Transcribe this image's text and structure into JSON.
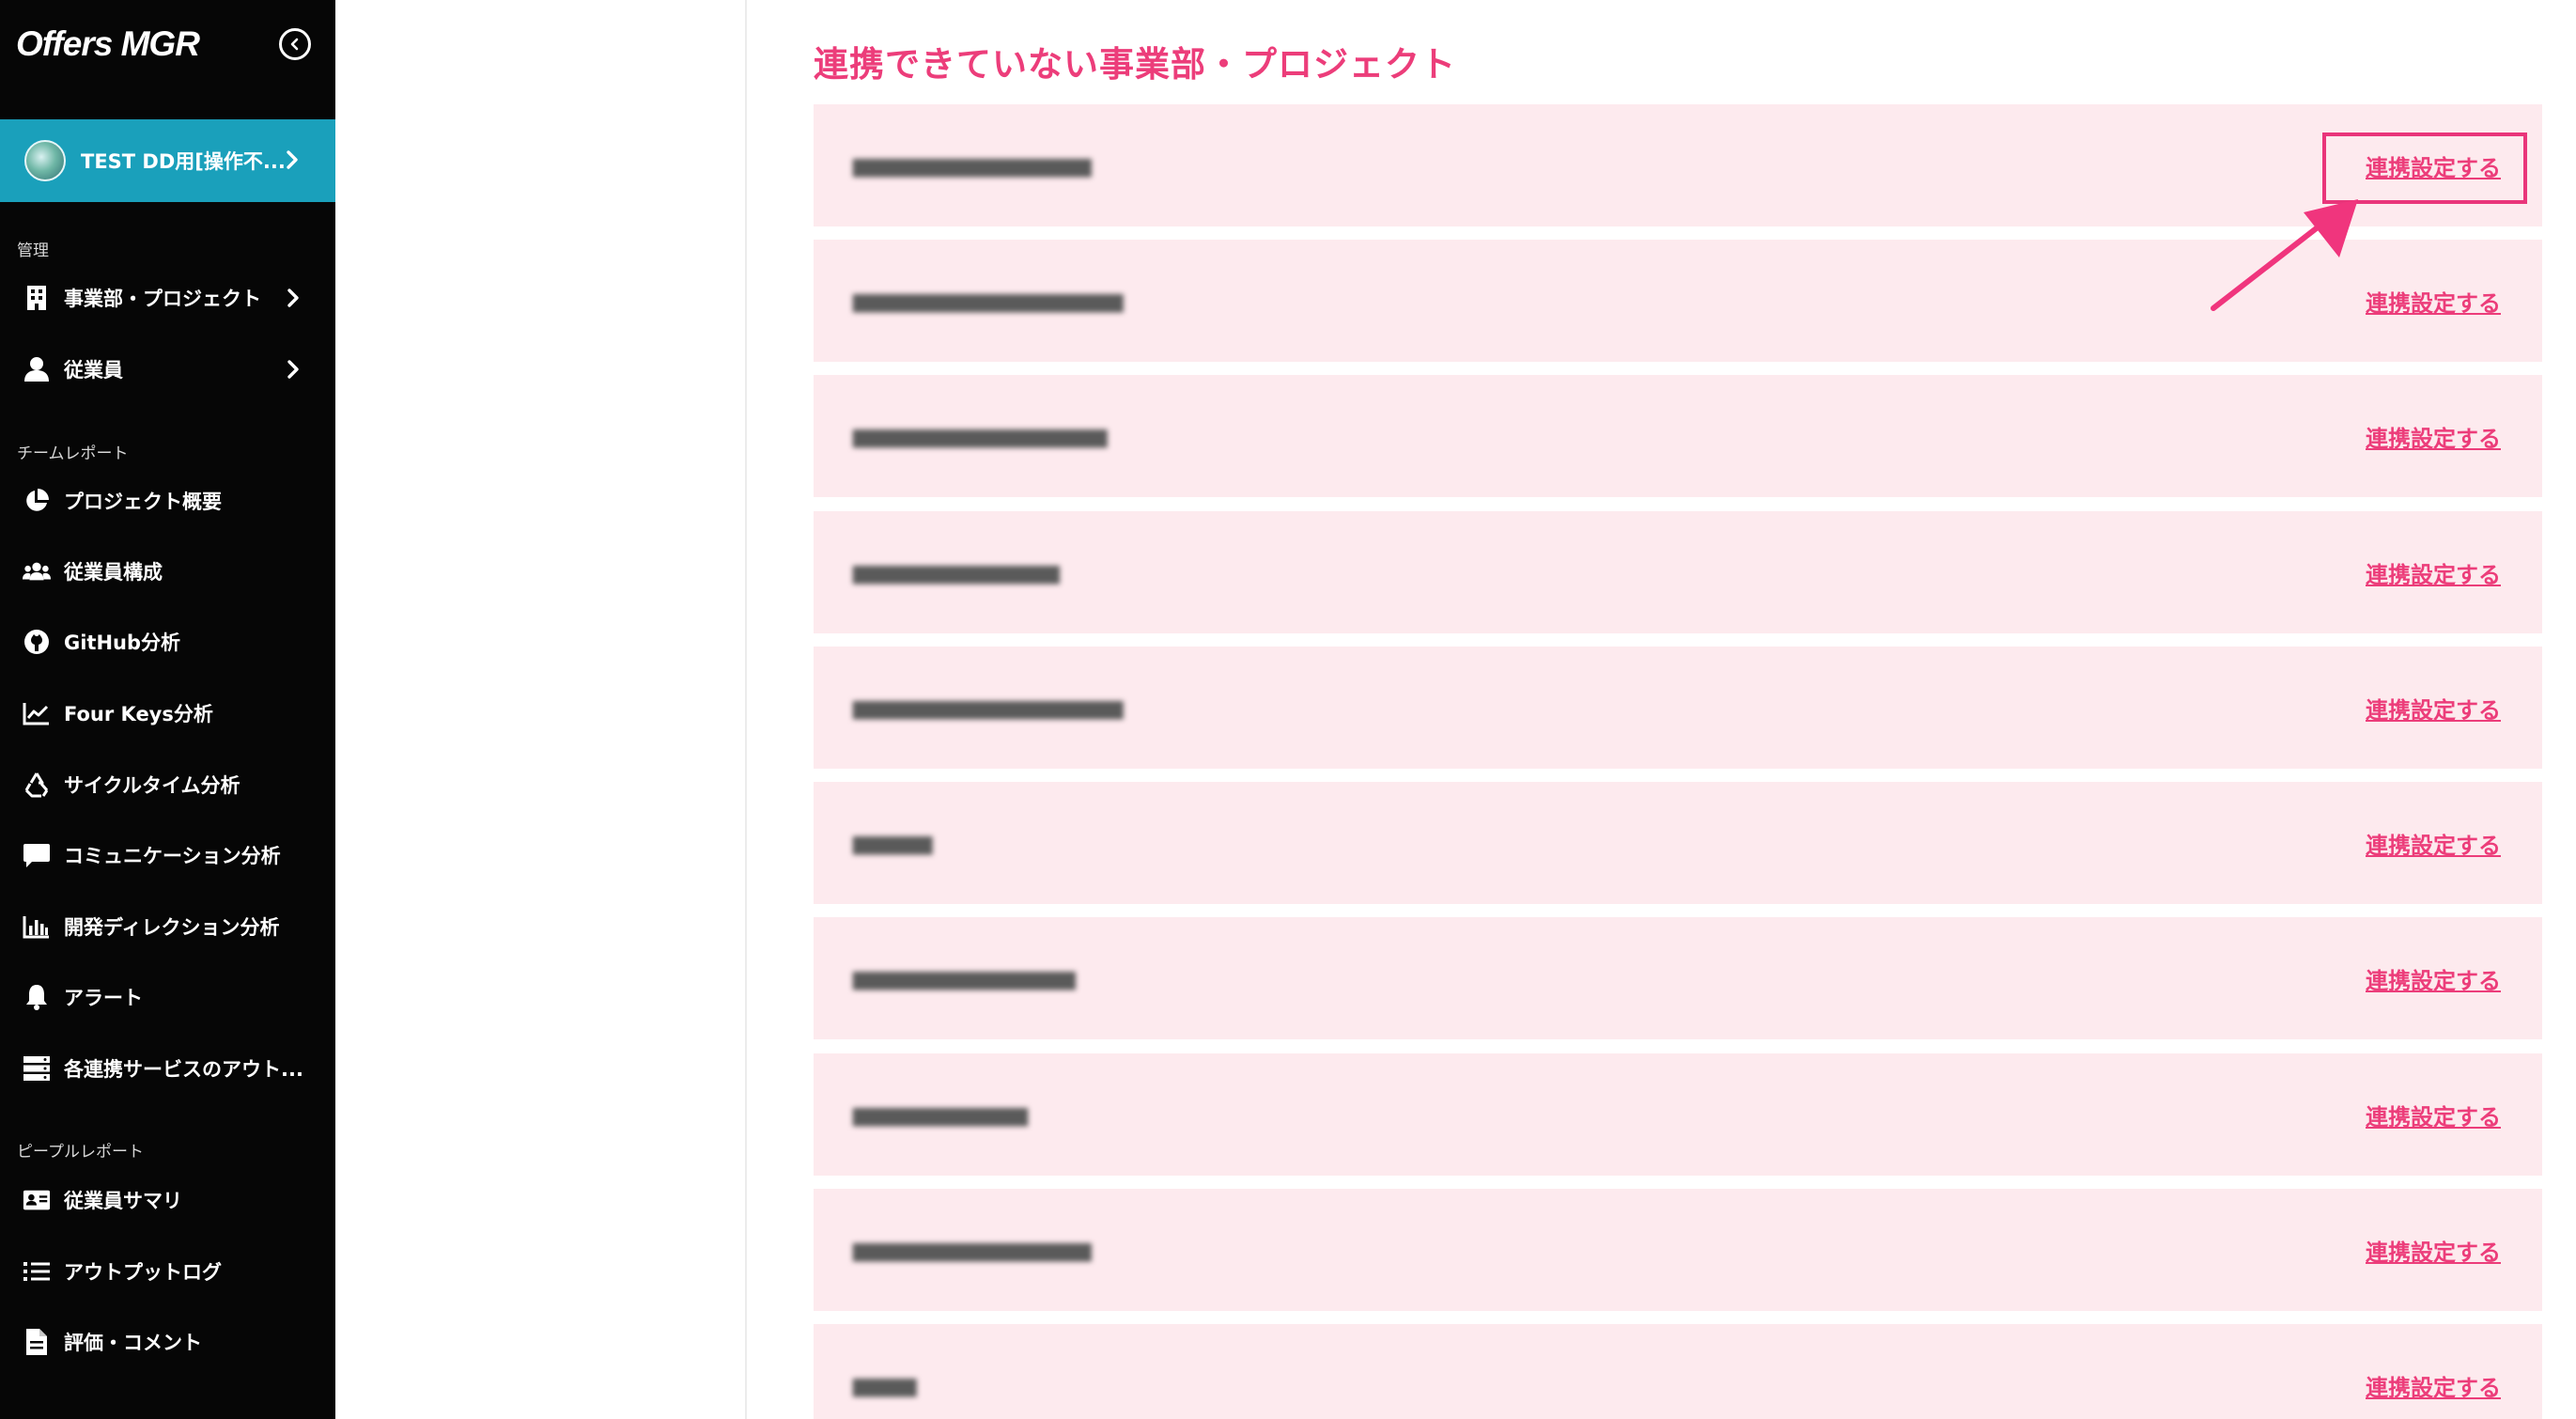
{
  "app": {
    "logo": "Offers MGR",
    "org_name": "TEST DD用[操作不..."
  },
  "sidebar": {
    "sections": [
      {
        "label": "管理",
        "items": [
          {
            "label": "事業部・プロジェクト",
            "icon": "building-icon",
            "chevron": true
          },
          {
            "label": "従業員",
            "icon": "user-icon",
            "chevron": true
          }
        ]
      },
      {
        "label": "チームレポート",
        "items": [
          {
            "label": "プロジェクト概要",
            "icon": "pie-chart-icon"
          },
          {
            "label": "従業員構成",
            "icon": "users-icon"
          },
          {
            "label": "GitHub分析",
            "icon": "github-icon"
          },
          {
            "label": "Four Keys分析",
            "icon": "line-chart-icon"
          },
          {
            "label": "サイクルタイム分析",
            "icon": "recycle-icon"
          },
          {
            "label": "コミュニケーション分析",
            "icon": "chat-bubble-icon"
          },
          {
            "label": "開発ディレクション分析",
            "icon": "bar-chart-icon"
          },
          {
            "label": "アラート",
            "icon": "bell-icon"
          },
          {
            "label": "各連携サービスのアウト...",
            "icon": "server-icon"
          }
        ]
      },
      {
        "label": "ピープルレポート",
        "items": [
          {
            "label": "従業員サマリ",
            "icon": "id-card-icon"
          },
          {
            "label": "アウトプットログ",
            "icon": "list-icon"
          },
          {
            "label": "評価・コメント",
            "icon": "document-icon"
          }
        ]
      }
    ]
  },
  "main": {
    "title": "連携できていない事業部・プロジェクト",
    "link_label": "連携設定する",
    "rows": [
      {
        "name": "▆▆▆▆▆▆▆▆▆▆▆▆▆▆▆"
      },
      {
        "name": "▆▆▆▆▆▆▆▆▆▆▆▆▆▆▆▆▆"
      },
      {
        "name": "▆▆▆▆▆▆▆▆▆▆▆▆▆▆▆▆"
      },
      {
        "name": "▆▆▆▆▆▆▆▆▆▆▆▆▆"
      },
      {
        "name": "▆▆▆▆▆▆▆▆▆▆▆▆▆▆▆▆▆"
      },
      {
        "name": "▆▆▆▆▆"
      },
      {
        "name": "▆▆▆▆▆▆▆▆▆▆▆▆▆▆"
      },
      {
        "name": "▆▆▆▆▆▆▆▆▆▆▆"
      },
      {
        "name": "▆▆▆▆▆▆▆▆▆▆▆▆▆▆▆"
      },
      {
        "name": "▆▆▆▆"
      }
    ]
  },
  "colors": {
    "accent": "#ec3d7a",
    "row_bg": "#fdeaee",
    "sidebar_bg": "#060606",
    "org_bar": "#1aa0bb"
  }
}
